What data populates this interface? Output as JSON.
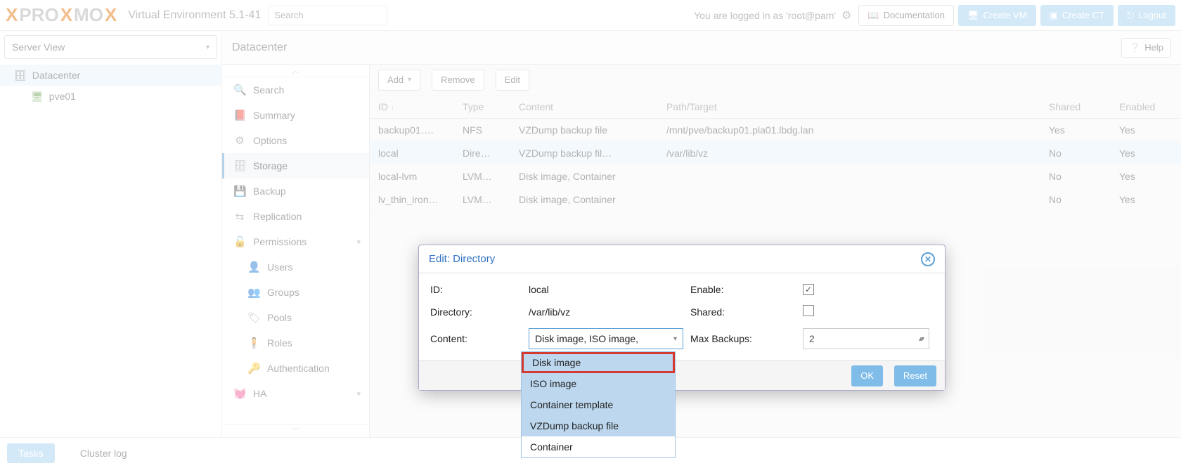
{
  "header": {
    "product": "PROXMOX",
    "env_label": "Virtual Environment 5.1-41",
    "search_placeholder": "Search",
    "logged_in_as": "You are logged in as 'root@pam'",
    "doc_btn": "Documentation",
    "create_vm_btn": "Create VM",
    "create_ct_btn": "Create CT",
    "logout_btn": "Logout"
  },
  "tree": {
    "view_label": "Server View",
    "root": "Datacenter",
    "node1": "pve01"
  },
  "center": {
    "breadcrumb": "Datacenter",
    "help_btn": "Help"
  },
  "side_menu": {
    "search": "Search",
    "summary": "Summary",
    "options": "Options",
    "storage": "Storage",
    "backup": "Backup",
    "replication": "Replication",
    "permissions": "Permissions",
    "users": "Users",
    "groups": "Groups",
    "pools": "Pools",
    "roles": "Roles",
    "authentication": "Authentication",
    "ha": "HA"
  },
  "toolbar": {
    "add": "Add",
    "remove": "Remove",
    "edit": "Edit"
  },
  "grid": {
    "cols": {
      "id": "ID",
      "type": "Type",
      "content": "Content",
      "path": "Path/Target",
      "shared": "Shared",
      "enabled": "Enabled"
    },
    "rows": [
      {
        "id": "backup01….",
        "type": "NFS",
        "content": "VZDump backup file",
        "path": "/mnt/pve/backup01.pla01.lbdg.lan",
        "shared": "Yes",
        "enabled": "Yes",
        "sel": false
      },
      {
        "id": "local",
        "type": "Dire…",
        "content": "VZDump backup fil…",
        "path": "/var/lib/vz",
        "shared": "No",
        "enabled": "Yes",
        "sel": true
      },
      {
        "id": "local-lvm",
        "type": "LVM…",
        "content": "Disk image, Container",
        "path": "",
        "shared": "No",
        "enabled": "Yes",
        "sel": false
      },
      {
        "id": "lv_thin_iron…",
        "type": "LVM…",
        "content": "Disk image, Container",
        "path": "",
        "shared": "No",
        "enabled": "Yes",
        "sel": false
      }
    ]
  },
  "modal": {
    "title": "Edit: Directory",
    "id_label": "ID:",
    "id_value": "local",
    "dir_label": "Directory:",
    "dir_value": "/var/lib/vz",
    "content_label": "Content:",
    "content_value": "Disk image, ISO image,",
    "enable_label": "Enable:",
    "enable_checked": true,
    "shared_label": "Shared:",
    "shared_checked": false,
    "maxbk_label": "Max Backups:",
    "maxbk_value": "2",
    "ok": "OK",
    "reset": "Reset"
  },
  "dropdown": {
    "items": [
      "Disk image",
      "ISO image",
      "Container template",
      "VZDump backup file",
      "Container"
    ],
    "highlighted_index": 0
  },
  "bottom": {
    "tasks": "Tasks",
    "cluster_log": "Cluster log"
  }
}
